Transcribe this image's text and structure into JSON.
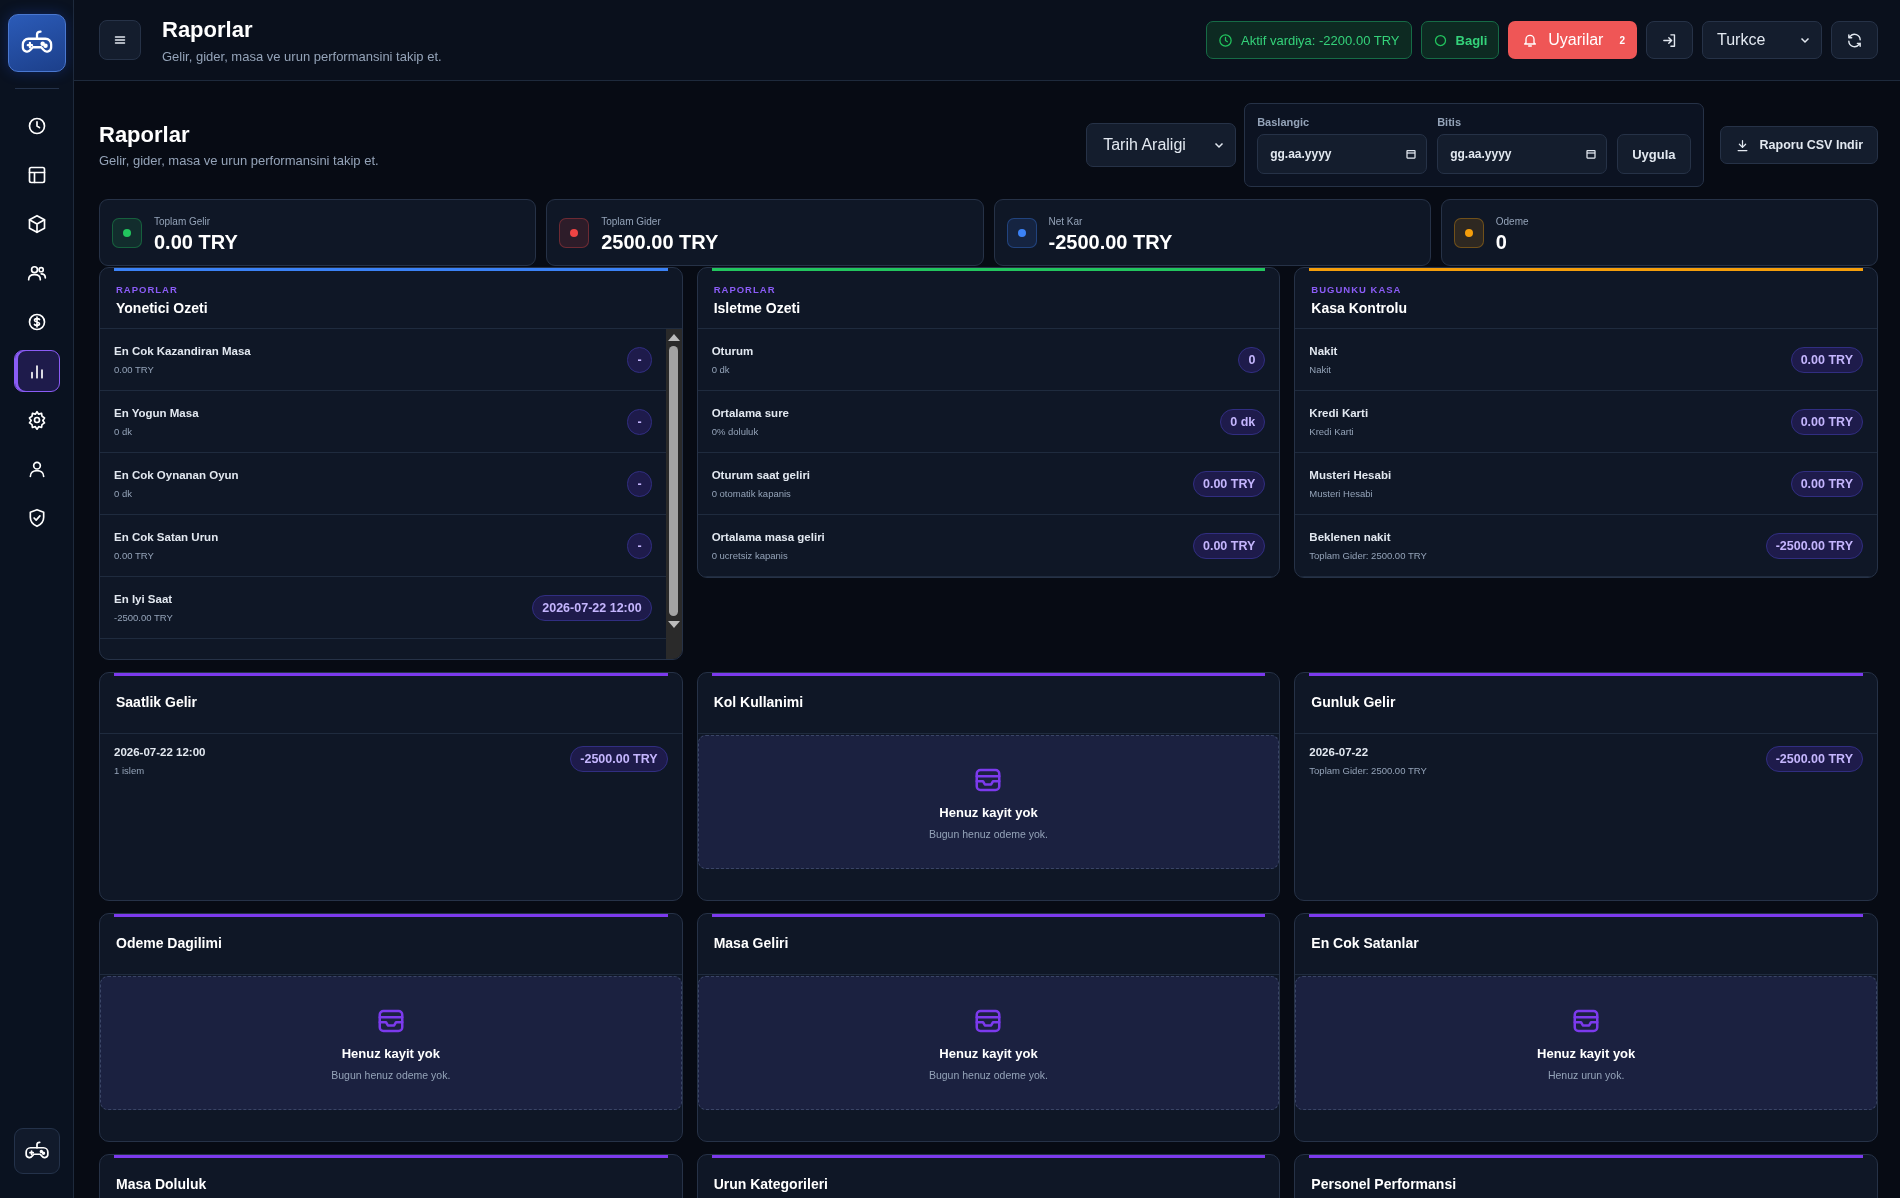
{
  "sidebar": {
    "items": [
      {
        "kind": "clock",
        "selected": false
      },
      {
        "kind": "tables",
        "selected": false
      },
      {
        "kind": "box",
        "selected": false
      },
      {
        "kind": "users",
        "selected": false
      },
      {
        "kind": "dollar",
        "selected": false
      },
      {
        "kind": "chart",
        "selected": true
      },
      {
        "kind": "settings",
        "selected": false
      },
      {
        "kind": "user",
        "selected": false
      },
      {
        "kind": "shield",
        "selected": false
      }
    ]
  },
  "header": {
    "title": "Raporlar",
    "subtitle": "Gelir, gider, masa ve urun performansini takip et.",
    "shift_status": "Aktif vardiya: -2200.00 TRY",
    "connection": "Bagli",
    "alerts": {
      "label": "Uyarilar",
      "count": "2"
    },
    "language": "Turkce"
  },
  "page": {
    "title": "Raporlar",
    "subtitle": "Gelir, gider, masa ve urun performansini takip et."
  },
  "filters": {
    "range": "Tarih Araligi",
    "start": {
      "label": "Baslangic",
      "placeholder": "gg.aa.yyyy"
    },
    "end": {
      "label": "Bitis",
      "placeholder": "gg.aa.yyyy"
    },
    "apply": "Uygula",
    "export": "Raporu CSV Indir"
  },
  "stats": [
    {
      "label": "Toplam Gelir",
      "value": "0.00 TRY",
      "color": "#22c55e"
    },
    {
      "label": "Toplam Gider",
      "value": "2500.00 TRY",
      "color": "#ef4444"
    },
    {
      "label": "Net Kar",
      "value": "-2500.00 TRY",
      "color": "#3b82f6"
    },
    {
      "label": "Odeme",
      "value": "0",
      "color": "#f59e0b"
    }
  ],
  "panels": [
    {
      "eyebrow": "RAPORLAR",
      "title": "Yonetici Ozeti",
      "color": "#3b82f6",
      "scroll": true,
      "rows": [
        {
          "label": "En Cok Kazandiran Masa",
          "detail": "0.00 TRY",
          "value": "-"
        },
        {
          "label": "En Yogun Masa",
          "detail": "0 dk",
          "value": "-"
        },
        {
          "label": "En Cok Oynanan Oyun",
          "detail": "0 dk",
          "value": "-"
        },
        {
          "label": "En Cok Satan Urun",
          "detail": "0.00 TRY",
          "value": "-"
        },
        {
          "label": "En Iyi Saat",
          "detail": "-2500.00 TRY",
          "value": "2026-07-22 12:00"
        }
      ]
    },
    {
      "eyebrow": "RAPORLAR",
      "title": "Isletme Ozeti",
      "color": "#22c55e",
      "rows": [
        {
          "label": "Oturum",
          "detail": "0 dk",
          "value": "0"
        },
        {
          "label": "Ortalama sure",
          "detail": "0% doluluk",
          "value": "0 dk"
        },
        {
          "label": "Oturum saat geliri",
          "detail": "0 otomatik kapanis",
          "value": "0.00 TRY"
        },
        {
          "label": "Ortalama masa geliri",
          "detail": "0 ucretsiz kapanis",
          "value": "0.00 TRY"
        }
      ]
    },
    {
      "eyebrow": "BUGUNKU KASA",
      "title": "Kasa Kontrolu",
      "color": "#f59e0b",
      "rows": [
        {
          "label": "Nakit",
          "detail": "Nakit",
          "value": "0.00 TRY"
        },
        {
          "label": "Kredi Karti",
          "detail": "Kredi Karti",
          "value": "0.00 TRY"
        },
        {
          "label": "Musteri Hesabi",
          "detail": "Musteri Hesabi",
          "value": "0.00 TRY"
        },
        {
          "label": "Beklenen nakit",
          "detail": "Toplam Gider: 2500.00 TRY",
          "value": "-2500.00 TRY"
        }
      ]
    },
    {
      "title": "Saatlik Gelir",
      "color": "#7c3aed",
      "rows": [
        {
          "label": "2026-07-22 12:00",
          "detail": "1 islem",
          "value": "-2500.00 TRY"
        }
      ]
    },
    {
      "title": "Kol Kullanimi",
      "color": "#7c3aed",
      "empty": {
        "title": "Henuz kayit yok",
        "message": "Bugun henuz odeme yok."
      }
    },
    {
      "title": "Gunluk Gelir",
      "color": "#7c3aed",
      "rows": [
        {
          "label": "2026-07-22",
          "detail": "Toplam Gider: 2500.00 TRY",
          "value": "-2500.00 TRY"
        }
      ]
    },
    {
      "title": "Odeme Dagilimi",
      "color": "#7c3aed",
      "empty": {
        "title": "Henuz kayit yok",
        "message": "Bugun henuz odeme yok."
      }
    },
    {
      "title": "Masa Geliri",
      "color": "#7c3aed",
      "empty": {
        "title": "Henuz kayit yok",
        "message": "Bugun henuz odeme yok."
      }
    },
    {
      "title": "En Cok Satanlar",
      "color": "#7c3aed",
      "empty": {
        "title": "Henuz kayit yok",
        "message": "Henuz urun yok."
      }
    },
    {
      "title": "Masa Doluluk",
      "color": "#7c3aed"
    },
    {
      "title": "Urun Kategorileri",
      "color": "#7c3aed"
    },
    {
      "title": "Personel Performansi",
      "color": "#7c3aed"
    }
  ]
}
